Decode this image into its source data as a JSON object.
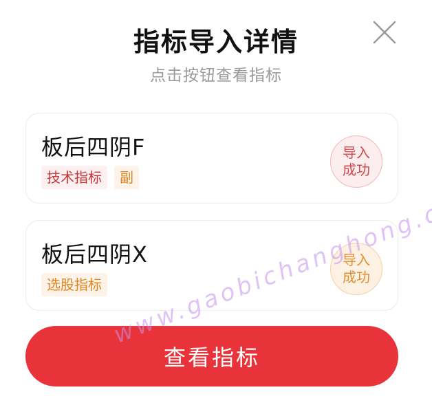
{
  "header": {
    "title": "指标导入详情",
    "subtitle": "点击按钮查看指标"
  },
  "close_icon": "close-icon",
  "indicators": [
    {
      "name": "板后四阴F",
      "tags": [
        "技术指标",
        "副"
      ],
      "status_line1": "导入",
      "status_line2": "成功"
    },
    {
      "name": "板后四阴X",
      "tags": [
        "选股指标"
      ],
      "status_line1": "导入",
      "status_line2": "成功"
    }
  ],
  "action": {
    "label": "查看指标"
  },
  "watermark": "www.gaobichanghong.com",
  "colors": {
    "accent": "#e9333a",
    "tag_red": "#c8363a",
    "tag_orange": "#e08420"
  }
}
